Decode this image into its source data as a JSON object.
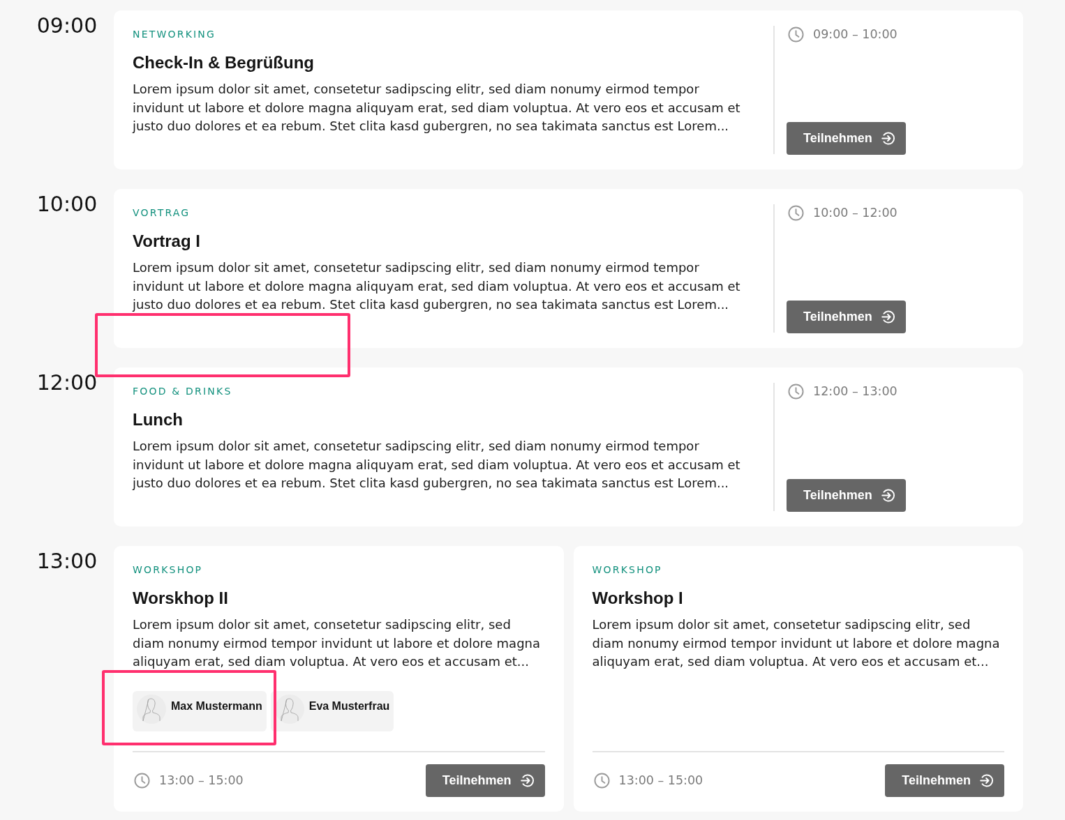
{
  "schedule": [
    {
      "time": "09:00",
      "sessions": [
        {
          "kind": "wide",
          "category": "NETWORKING",
          "title": "Check-In & Begrüßung",
          "description": "Lorem ipsum dolor sit amet, consetetur sadipscing elitr, sed diam nonumy eirmod tempor invidunt ut labore et dolore magna aliquyam erat, sed diam voluptua. At vero eos et accusam et justo duo dolores et ea rebum. Stet clita kasd gubergren, no sea takimata sanctus est Lorem...",
          "time_range": "09:00 – 10:00",
          "button": "Teilnehmen",
          "highlighted": false
        }
      ]
    },
    {
      "time": "10:00",
      "sessions": [
        {
          "kind": "wide",
          "category": "VORTRAG",
          "title": "Vortrag I",
          "description": "Lorem ipsum dolor sit amet, consetetur sadipscing elitr, sed diam nonumy eirmod tempor invidunt ut labore et dolore magna aliquyam erat, sed diam voluptua. At vero eos et accusam et justo duo dolores et ea rebum. Stet clita kasd gubergren, no sea takimata sanctus est Lorem...",
          "time_range": "10:00 – 12:00",
          "button": "Teilnehmen",
          "highlighted": true
        }
      ]
    },
    {
      "time": "12:00",
      "sessions": [
        {
          "kind": "wide",
          "category": "FOOD & DRINKS",
          "title": "Lunch",
          "description": "Lorem ipsum dolor sit amet, consetetur sadipscing elitr, sed diam nonumy eirmod tempor invidunt ut labore et dolore magna aliquyam erat, sed diam voluptua. At vero eos et accusam et justo duo dolores et ea rebum. Stet clita kasd gubergren, no sea takimata sanctus est Lorem...",
          "time_range": "12:00 – 13:00",
          "button": "Teilnehmen",
          "highlighted": false
        }
      ]
    },
    {
      "time": "13:00",
      "sessions": [
        {
          "kind": "half",
          "category": "WORKSHOP",
          "title": "Worskhop II",
          "description": "Lorem ipsum dolor sit amet, consetetur sadipscing elitr, sed diam nonumy eirmod tempor invidunt ut labore et dolore magna aliquyam erat, sed diam voluptua. At vero eos et accusam et...",
          "speakers": [
            {
              "name": "Max Mustermann",
              "highlighted": true
            },
            {
              "name": "Eva Musterfrau",
              "highlighted": false
            }
          ],
          "time_range": "13:00 – 15:00",
          "button": "Teilnehmen",
          "highlighted": false
        },
        {
          "kind": "half",
          "category": "WORKSHOP",
          "title": "Workshop I",
          "description": "Lorem ipsum dolor sit amet, consetetur sadipscing elitr, sed diam nonumy eirmod tempor invidunt ut labore et dolore magna aliquyam erat, sed diam voluptua. At vero eos et accusam et...",
          "time_range": "13:00 – 15:00",
          "button": "Teilnehmen",
          "highlighted": false
        }
      ]
    }
  ]
}
